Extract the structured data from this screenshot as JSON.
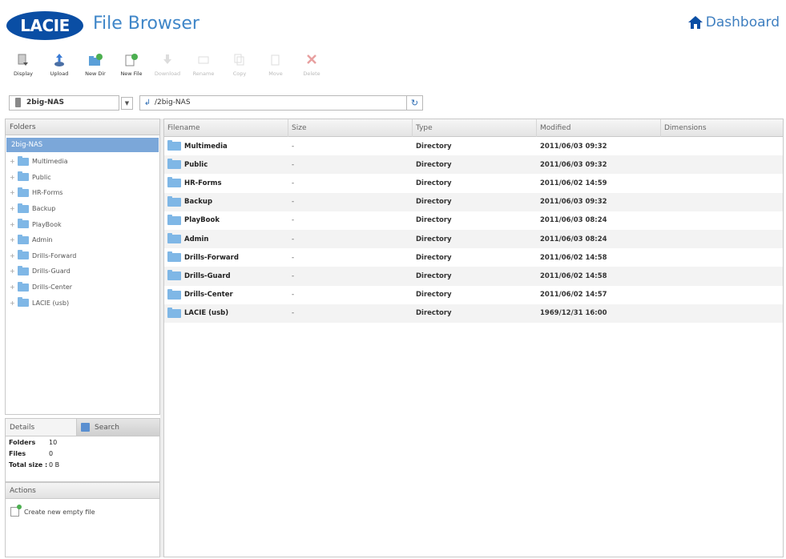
{
  "header": {
    "logo_text": "LACIE",
    "title": "File Browser",
    "dashboard_label": "Dashboard"
  },
  "toolbar": [
    {
      "label": "Display",
      "icon": "display-icon",
      "enabled": true
    },
    {
      "label": "Upload",
      "icon": "upload-icon",
      "enabled": true
    },
    {
      "label": "New Dir",
      "icon": "new-dir-icon",
      "enabled": true
    },
    {
      "label": "New File",
      "icon": "new-file-icon",
      "enabled": true
    },
    {
      "label": "Download",
      "icon": "download-icon",
      "enabled": false
    },
    {
      "label": "Rename",
      "icon": "rename-icon",
      "enabled": false
    },
    {
      "label": "Copy",
      "icon": "copy-icon",
      "enabled": false
    },
    {
      "label": "Move",
      "icon": "move-icon",
      "enabled": false
    },
    {
      "label": "Delete",
      "icon": "delete-icon",
      "enabled": false
    }
  ],
  "pathbar": {
    "volume": "2big-NAS",
    "path": "/2big-NAS"
  },
  "folders_panel": {
    "title": "Folders",
    "root": "2big-NAS",
    "items": [
      "Multimedia",
      "Public",
      "HR-Forms",
      "Backup",
      "PlayBook",
      "Admin",
      "Drills-Forward",
      "Drills-Guard",
      "Drills-Center",
      "LACIE (usb)"
    ]
  },
  "details_panel": {
    "tab_details": "Details",
    "tab_search": "Search",
    "rows": [
      {
        "key": "Folders",
        "value": "10"
      },
      {
        "key": "Files",
        "value": "0"
      },
      {
        "key": "Total size :",
        "value": "0 B"
      }
    ]
  },
  "actions_panel": {
    "title": "Actions",
    "items": [
      "Create new empty file"
    ]
  },
  "files_table": {
    "columns": [
      "Filename",
      "Size",
      "Type",
      "Modified",
      "Dimensions"
    ],
    "rows": [
      {
        "name": "Multimedia",
        "size": "-",
        "type": "Directory",
        "modified": "2011/06/03 09:32",
        "dimensions": ""
      },
      {
        "name": "Public",
        "size": "-",
        "type": "Directory",
        "modified": "2011/06/03 09:32",
        "dimensions": ""
      },
      {
        "name": "HR-Forms",
        "size": "-",
        "type": "Directory",
        "modified": "2011/06/02 14:59",
        "dimensions": ""
      },
      {
        "name": "Backup",
        "size": "-",
        "type": "Directory",
        "modified": "2011/06/03 09:32",
        "dimensions": ""
      },
      {
        "name": "PlayBook",
        "size": "-",
        "type": "Directory",
        "modified": "2011/06/03 08:24",
        "dimensions": ""
      },
      {
        "name": "Admin",
        "size": "-",
        "type": "Directory",
        "modified": "2011/06/03 08:24",
        "dimensions": ""
      },
      {
        "name": "Drills-Forward",
        "size": "-",
        "type": "Directory",
        "modified": "2011/06/02 14:58",
        "dimensions": ""
      },
      {
        "name": "Drills-Guard",
        "size": "-",
        "type": "Directory",
        "modified": "2011/06/02 14:58",
        "dimensions": ""
      },
      {
        "name": "Drills-Center",
        "size": "-",
        "type": "Directory",
        "modified": "2011/06/02 14:57",
        "dimensions": ""
      },
      {
        "name": "LACIE (usb)",
        "size": "-",
        "type": "Directory",
        "modified": "1969/12/31 16:00",
        "dimensions": ""
      }
    ]
  },
  "colors": {
    "brand": "#0a4ea4",
    "title": "#3f86c8",
    "selection": "#7ba7d9",
    "folder": "#7fb7e6"
  }
}
